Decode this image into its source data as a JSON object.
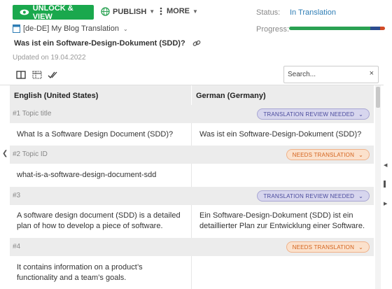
{
  "toolbar": {
    "unlock_label": "UNLOCK & VIEW",
    "publish_label": "PUBLISH",
    "more_label": "MORE",
    "unlock_color": "#1aa84d"
  },
  "status": {
    "label": "Status:",
    "value": "In Translation",
    "progress_label": "Progress:",
    "progress": {
      "translated": 0.85,
      "review": 0.1,
      "needs": 0.05
    }
  },
  "project": {
    "name": "[de-DE] My Blog Translation",
    "doc_title": "Was ist ein Software-Design-Dokument (SDD)?",
    "updated": "Updated on 19.04.2022"
  },
  "search": {
    "placeholder": "Search...",
    "clear": "×"
  },
  "table": {
    "col_source": "English (United States)",
    "col_target": "German (Germany)",
    "segments": [
      {
        "label": "#1  Topic title",
        "status": "TRANSLATION REVIEW NEEDED",
        "status_kind": "review",
        "source": "What Is a Software Design Document (SDD)?",
        "target": "Was ist ein Software-Design-Dokument (SDD)?"
      },
      {
        "label": "#2  Topic ID",
        "status": "NEEDS TRANSLATION",
        "status_kind": "needs",
        "source": "what-is-a-software-design-document-sdd",
        "target": ""
      },
      {
        "label": "#3",
        "status": "TRANSLATION REVIEW NEEDED",
        "status_kind": "review",
        "source": "A software design document (SDD) is a detailed plan of how to develop a piece of software.",
        "target": "Ein Software-Design-Dokument (SDD) ist ein detaillierter Plan zur Entwicklung einer Software."
      },
      {
        "label": "#4",
        "status": "NEEDS TRANSLATION",
        "status_kind": "needs",
        "source": "It contains information on a product’s functionality and a team’s goals.",
        "target": ""
      }
    ]
  }
}
